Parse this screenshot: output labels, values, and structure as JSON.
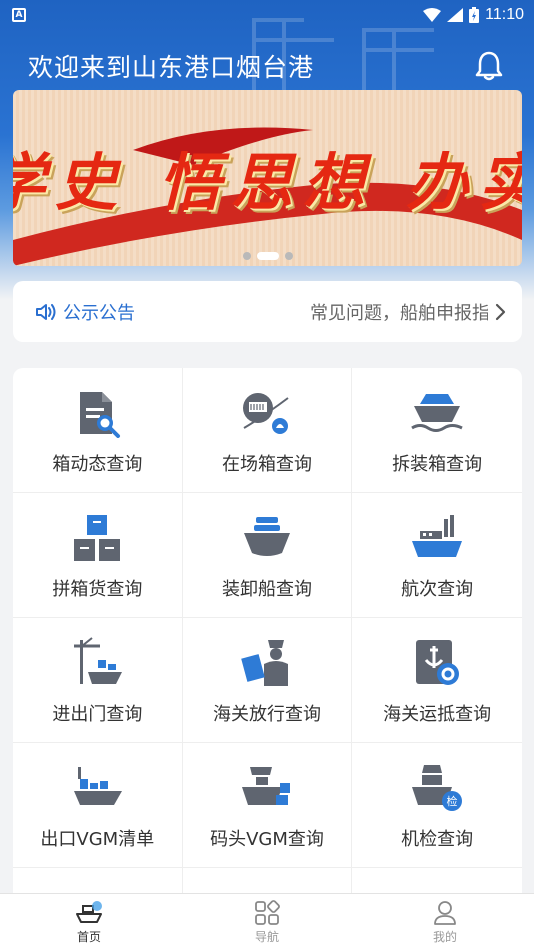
{
  "status_bar": {
    "app_badge": "A",
    "time": "11:10"
  },
  "header": {
    "title": "欢迎来到山东港口烟台港"
  },
  "banner": {
    "slogan": "学史 悟思想 办实事",
    "slide_count": 3,
    "active_slide": 2
  },
  "notice": {
    "label": "公示公告",
    "ticker": "常见问题，船舶申报指南"
  },
  "menu": [
    {
      "label": "箱动态查询",
      "icon": "container-status-search-icon"
    },
    {
      "label": "在场箱查询",
      "icon": "yard-container-icon"
    },
    {
      "label": "拆装箱查询",
      "icon": "stuffing-ship-icon"
    },
    {
      "label": "拼箱货查询",
      "icon": "lcl-boxes-icon"
    },
    {
      "label": "装卸船查询",
      "icon": "loading-ship-icon"
    },
    {
      "label": "航次查询",
      "icon": "voyage-ship-icon"
    },
    {
      "label": "进出门查询",
      "icon": "gate-crane-icon"
    },
    {
      "label": "海关放行查询",
      "icon": "customs-release-icon"
    },
    {
      "label": "海关运抵查询",
      "icon": "customs-arrival-icon"
    },
    {
      "label": "出口VGM清单",
      "icon": "export-vgm-icon"
    },
    {
      "label": "码头VGM查询",
      "icon": "terminal-vgm-icon"
    },
    {
      "label": "机检查询",
      "icon": "machine-inspection-icon",
      "badge": "检"
    }
  ],
  "tabs": [
    {
      "label": "首页",
      "active": true
    },
    {
      "label": "导航",
      "active": false
    },
    {
      "label": "我的",
      "active": false
    }
  ],
  "colors": {
    "brand_blue": "#2a6fd0",
    "icon_gray": "#5f6570",
    "icon_blue": "#2e7bd6",
    "slogan_red": "#e52812"
  }
}
